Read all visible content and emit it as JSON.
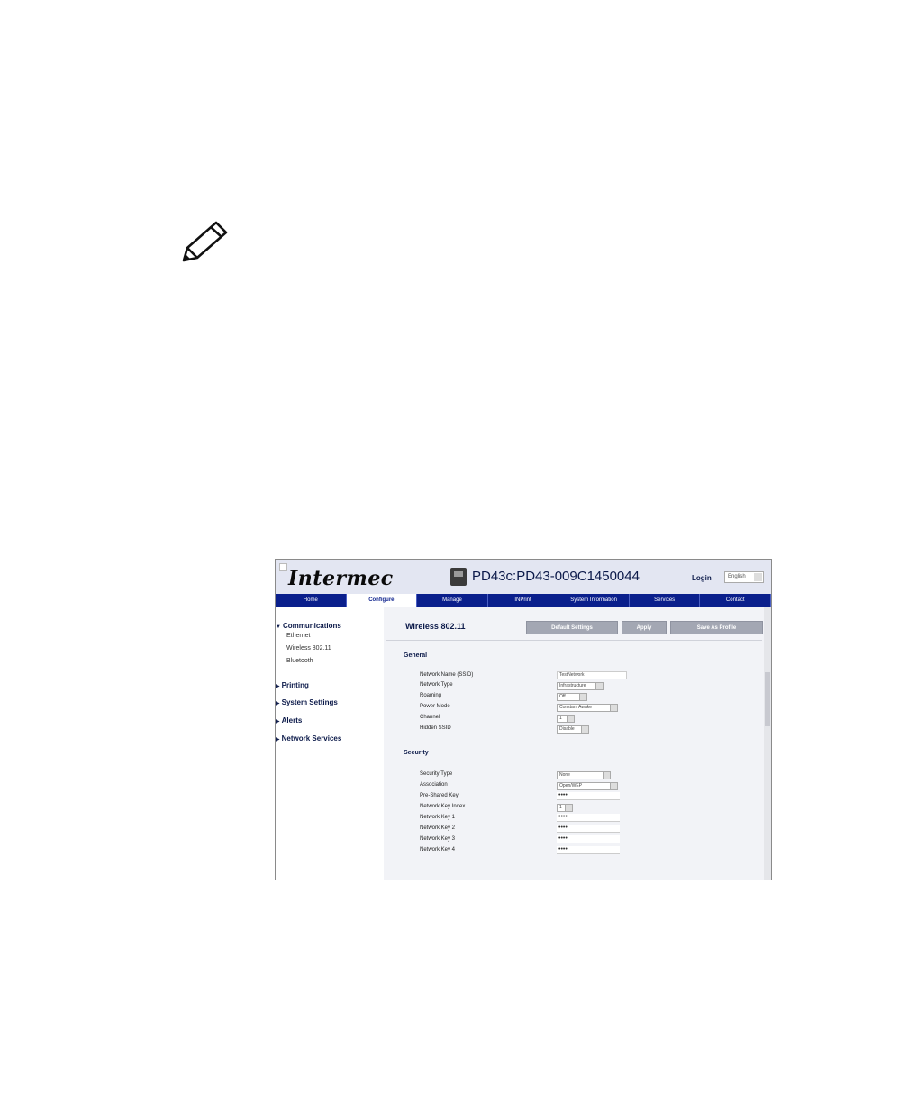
{
  "note_icon": "pencil-icon",
  "app": {
    "logo": "Intermec",
    "device_name": "PD43c:PD43-009C1450044",
    "login": "Login",
    "language": "English"
  },
  "tabs": [
    {
      "label": "Home",
      "active": false
    },
    {
      "label": "Configure",
      "active": true
    },
    {
      "label": "Manage",
      "active": false
    },
    {
      "label": "INPrint",
      "active": false
    },
    {
      "label": "System Information",
      "active": false
    },
    {
      "label": "Services",
      "active": false
    },
    {
      "label": "Contact",
      "active": false
    }
  ],
  "sidebar": {
    "communications": "Communications",
    "ethernet": "Ethernet",
    "wireless": "Wireless 802.11",
    "bluetooth": "Bluetooth",
    "printing": "Printing",
    "system_settings": "System Settings",
    "alerts": "Alerts",
    "network_services": "Network Services"
  },
  "main": {
    "title": "Wireless 802.11",
    "buttons": {
      "default_settings": "Default Settings",
      "apply": "Apply",
      "save_as_profile": "Save As Profile"
    },
    "general": {
      "heading": "General",
      "fields": [
        {
          "label": "Network Name (SSID)",
          "value": "TestNetwork"
        },
        {
          "label": "Network Type",
          "value": "Infrastructure"
        },
        {
          "label": "Roaming",
          "value": "Off"
        },
        {
          "label": "Power Mode",
          "value": "Constant Awake"
        },
        {
          "label": "Channel",
          "value": "1"
        },
        {
          "label": "Hidden SSID",
          "value": "Disable"
        }
      ]
    },
    "security": {
      "heading": "Security",
      "fields": [
        {
          "label": "Security Type",
          "value": "None"
        },
        {
          "label": "Association",
          "value": "Open/WEP"
        },
        {
          "label": "Pre-Shared Key",
          "value": "••••"
        },
        {
          "label": "Network Key Index",
          "value": "1"
        },
        {
          "label": "Network Key 1",
          "value": "••••"
        },
        {
          "label": "Network Key 2",
          "value": "••••"
        },
        {
          "label": "Network Key 3",
          "value": "••••"
        },
        {
          "label": "Network Key 4",
          "value": "••••"
        }
      ]
    }
  }
}
